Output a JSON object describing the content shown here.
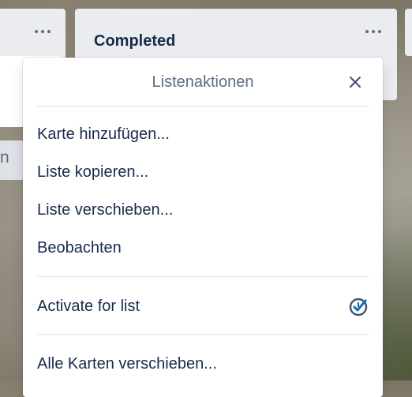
{
  "board": {
    "left_list": {
      "partial_label": "n"
    },
    "right_list": {
      "title": "Completed"
    }
  },
  "popover": {
    "title": "Listenaktionen",
    "close_icon": "close-icon",
    "items": [
      {
        "label": "Karte hinzufügen..."
      },
      {
        "label": "Liste kopieren..."
      },
      {
        "label": "Liste verschieben..."
      },
      {
        "label": "Beobachten"
      }
    ],
    "powerup": {
      "label": "Activate for list",
      "icon": "check-clock-icon",
      "icon_color": "#42526e"
    },
    "move_all": {
      "label": "Alle Karten verschieben..."
    }
  },
  "colors": {
    "list_bg": "#ebecf0",
    "title_text": "#172b4d",
    "muted_text": "#5e6c84",
    "separator": "#dfe1e6"
  }
}
